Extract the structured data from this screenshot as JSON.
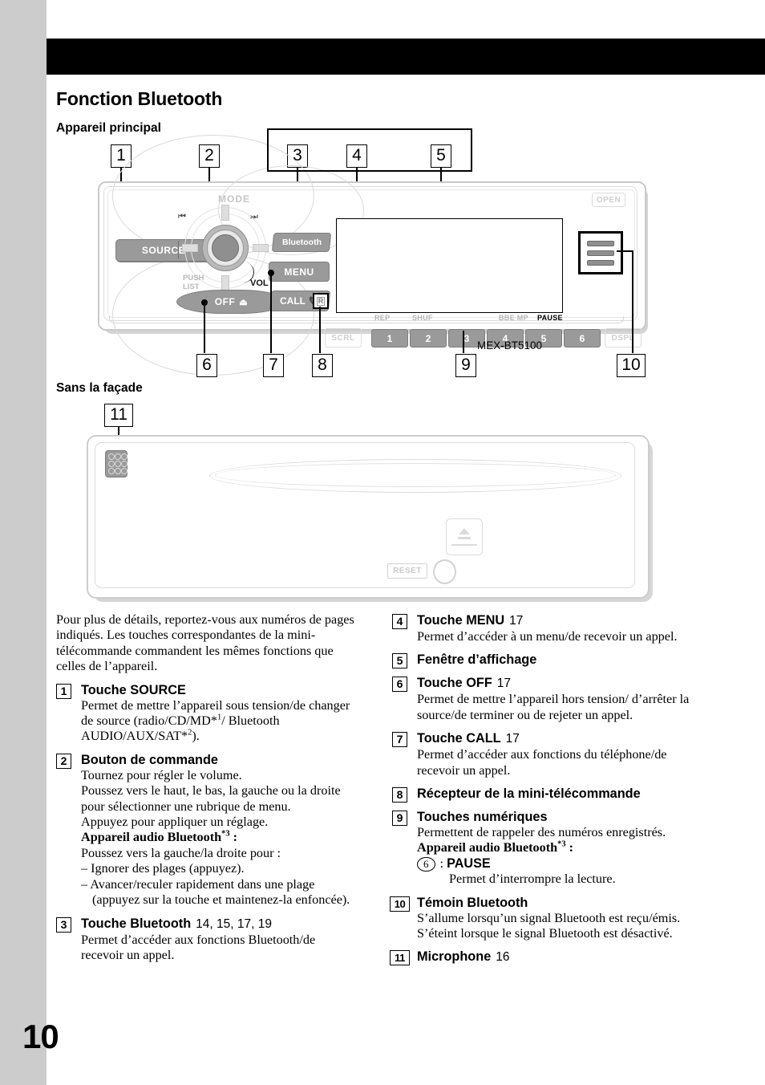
{
  "page": {
    "number": "10"
  },
  "headings": {
    "title": "Fonction Bluetooth",
    "sub_main_unit": "Appareil principal",
    "sub_without_panel": "Sans la façade"
  },
  "diagram": {
    "model_number": "MEX-BT5100",
    "callouts_top": [
      "1",
      "2",
      "3",
      "4",
      "5"
    ],
    "callouts_bottom": [
      "6",
      "7",
      "8",
      "9",
      "10"
    ],
    "callout_lower": "11",
    "unit_labels": {
      "source": "SOURCE",
      "mode": "MODE",
      "push_list_1": "PUSH",
      "push_list_2": "LIST",
      "vol": "VOL",
      "off": "OFF",
      "bluetooth": "Bluetooth",
      "menu": "MENU",
      "call": "CALL",
      "open": "OPEN",
      "scrl": "SCRL",
      "dspl": "DSPL",
      "r_button": "R",
      "skip_back": "⏮",
      "skip_fwd": "⏭"
    },
    "preset_labels": [
      "REP",
      "SHUF",
      "",
      "",
      "BBE MP",
      "PAUSE"
    ],
    "preset_buttons": [
      "1",
      "2",
      "3",
      "4",
      "5",
      "6"
    ],
    "lower_labels": {
      "reset": "RESET"
    }
  },
  "intro": "Pour plus de détails, reportez-vous aux numéros de pages indiqués. Les touches correspondantes de la mini-télécommande commandent les mêmes fonctions que celles de l’appareil.",
  "items": {
    "i1": {
      "num": "1",
      "title": "Touche SOURCE",
      "page": "",
      "body": "Permet de mettre l’appareil sous tension/de changer de source (radio/CD/MD*1/ Bluetooth AUDIO/AUX/SAT*2)."
    },
    "i2": {
      "num": "2",
      "title": "Bouton de commande",
      "page": "",
      "l1": "Tournez pour régler le volume.",
      "l2": "Poussez vers le haut, le bas, la gauche ou la droite pour sélectionner une rubrique de menu.",
      "l3": "Appuyez pour appliquer un réglage.",
      "l4": "Appareil audio Bluetooth",
      "l4sup": "*3",
      "l4tail": " :",
      "l5": "Poussez vers la gauche/la droite pour :",
      "l6": "– Ignorer des plages (appuyez).",
      "l7": "– Avancer/reculer rapidement dans une plage (appuyez sur la touche et maintenez-la enfoncée)."
    },
    "i3": {
      "num": "3",
      "title": "Touche Bluetooth",
      "page": "14, 15, 17, 19",
      "body": "Permet d’accéder aux fonctions Bluetooth/de recevoir un appel."
    },
    "i4": {
      "num": "4",
      "title": "Touche MENU",
      "page": "17",
      "body": "Permet d’accéder à un menu/de recevoir un appel."
    },
    "i5": {
      "num": "5",
      "title": "Fenêtre d’affichage",
      "page": "",
      "body": ""
    },
    "i6": {
      "num": "6",
      "title": "Touche OFF",
      "page": "17",
      "body": "Permet de mettre l’appareil hors tension/ d’arrêter la source/de terminer ou de rejeter un appel."
    },
    "i7": {
      "num": "7",
      "title": "Touche CALL",
      "page": "17",
      "body": "Permet d’accéder aux fonctions du téléphone/de recevoir un appel."
    },
    "i8": {
      "num": "8",
      "title": "Récepteur de la mini-télécommande",
      "page": "",
      "body": ""
    },
    "i9": {
      "num": "9",
      "title": "Touches numériques",
      "page": "",
      "l1": "Permettent de rappeler des numéros enregistrés.",
      "l2": "Appareil audio Bluetooth",
      "l2sup": "*3",
      "l2tail": " :",
      "l3_circle": "6",
      "l3_sep": " : ",
      "l3_label": "PAUSE",
      "l4": "Permet d’interrompre la lecture."
    },
    "i10": {
      "num": "10",
      "title": "Témoin Bluetooth",
      "page": "",
      "body": "S’allume lorsqu’un signal Bluetooth est reçu/émis. S’éteint lorsque le signal Bluetooth est désactivé."
    },
    "i11": {
      "num": "11",
      "title": "Microphone",
      "page": "16",
      "body": ""
    }
  }
}
